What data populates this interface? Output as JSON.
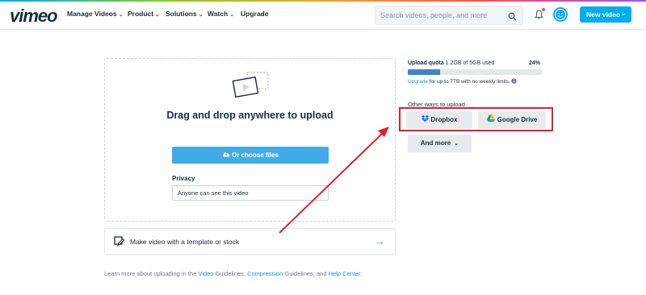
{
  "header": {
    "logo": "vimeo",
    "nav": [
      "Manage Videos",
      "Product",
      "Solutions",
      "Watch",
      "Upgrade"
    ],
    "search_placeholder": "Search videos, people, and more",
    "new_video_label": "New video"
  },
  "upload": {
    "title": "Drag and drop anywhere to upload",
    "choose_files_label": "Or choose files",
    "privacy_label": "Privacy",
    "privacy_value": "Anyone can see this video"
  },
  "template_card": {
    "label": "Make video with a template or stock"
  },
  "footer": {
    "prefix": "Learn more about uploading in the ",
    "link1": "Video",
    "mid1": " Guidelines, ",
    "link2": "Compression",
    "mid2": " Guidelines, and ",
    "link3": "Help Center",
    "suffix": "."
  },
  "quota": {
    "label_bold": "Upload quota",
    "label_detail": " 1.2GB of 5GB used",
    "percent_label": "24%",
    "percent": 24,
    "upgrade_link": "Upgrade",
    "upgrade_text": " for up to 7TB with no weekly limits."
  },
  "other_ways": {
    "label": "Other ways to upload",
    "dropbox": "Dropbox",
    "google_drive": "Google Drive",
    "and_more": "And more"
  },
  "colors": {
    "accent": "#00adef",
    "primary_button": "#41abe8",
    "quota_fill": "#3a86c8",
    "annotation": "#e0202a"
  }
}
